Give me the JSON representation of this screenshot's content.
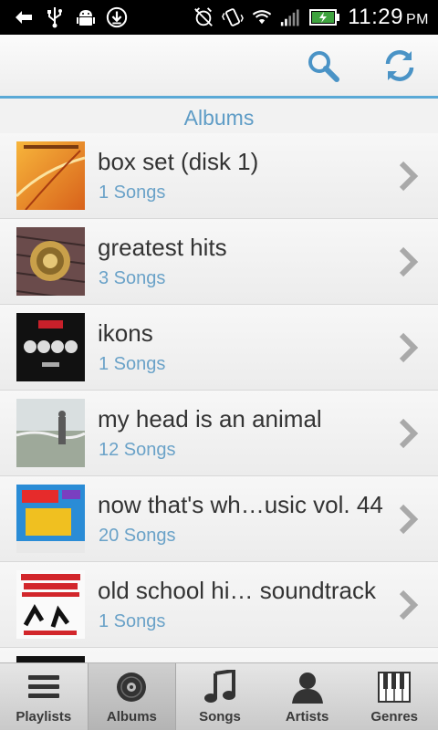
{
  "status_bar": {
    "time": "11:29",
    "ampm": "PM",
    "icons": [
      "back-arrow-icon",
      "usb-icon",
      "android-debug-icon",
      "download-icon",
      "alarm-off-icon",
      "vibrate-icon",
      "wifi-icon",
      "signal-icon",
      "battery-charging-icon"
    ]
  },
  "action_bar": {
    "search_icon": "search-icon",
    "refresh_icon": "refresh-icon"
  },
  "section_title": "Albums",
  "albums": [
    {
      "title": "box set (disk 1)",
      "songs": "1 Songs"
    },
    {
      "title": "greatest hits",
      "songs": "3 Songs"
    },
    {
      "title": "ikons",
      "songs": "1 Songs"
    },
    {
      "title": "my head is an animal",
      "songs": "12 Songs"
    },
    {
      "title": "now that's wh…usic vol. 44",
      "songs": "20 Songs"
    },
    {
      "title": "old school hi… soundtrack",
      "songs": "1 Songs"
    }
  ],
  "tabs": [
    {
      "label": "Playlists",
      "icon": "playlist-icon",
      "active": false
    },
    {
      "label": "Albums",
      "icon": "album-disc-icon",
      "active": true
    },
    {
      "label": "Songs",
      "icon": "music-note-icon",
      "active": false
    },
    {
      "label": "Artists",
      "icon": "person-icon",
      "active": false
    },
    {
      "label": "Genres",
      "icon": "piano-keys-icon",
      "active": false
    }
  ],
  "colors": {
    "accent": "#5aa9d6",
    "subtitle": "#6aa2c8",
    "title_text": "#333333"
  }
}
